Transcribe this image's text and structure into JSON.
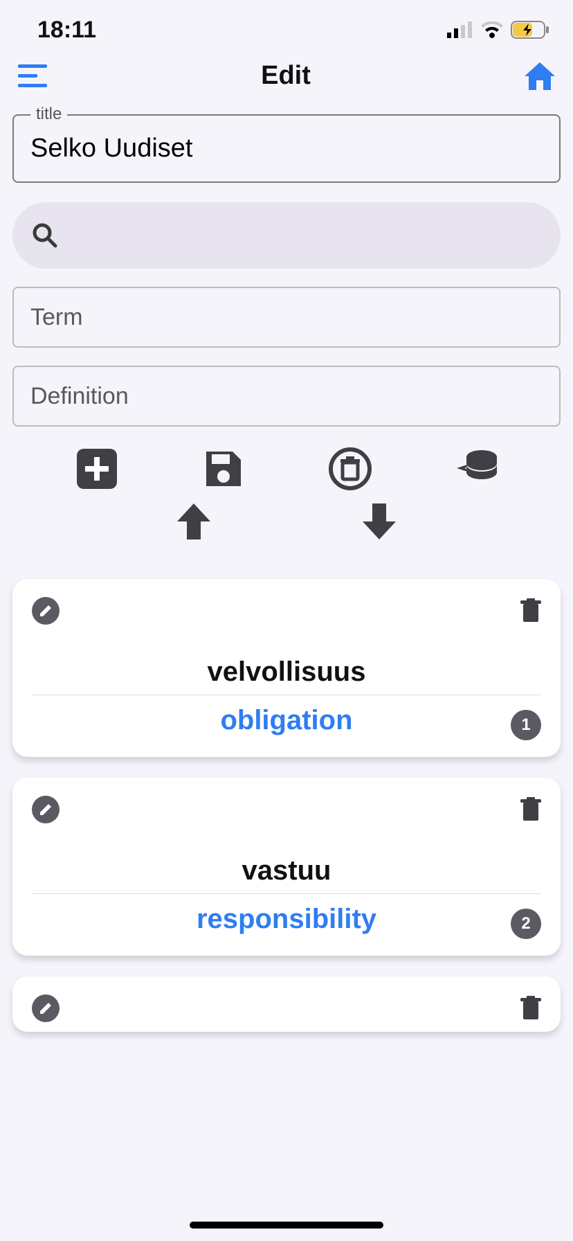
{
  "status": {
    "time": "18:11"
  },
  "header": {
    "title": "Edit"
  },
  "title_field": {
    "label": "title",
    "value": "Selko Uudiset"
  },
  "search": {
    "placeholder": ""
  },
  "term_input": {
    "placeholder": "Term"
  },
  "definition_input": {
    "placeholder": "Definition"
  },
  "cards": [
    {
      "term": "velvollisuus",
      "definition": "obligation",
      "badge": "1"
    },
    {
      "term": "vastuu",
      "definition": "responsibility",
      "badge": "2"
    },
    {
      "term": "",
      "definition": "",
      "badge": ""
    }
  ]
}
